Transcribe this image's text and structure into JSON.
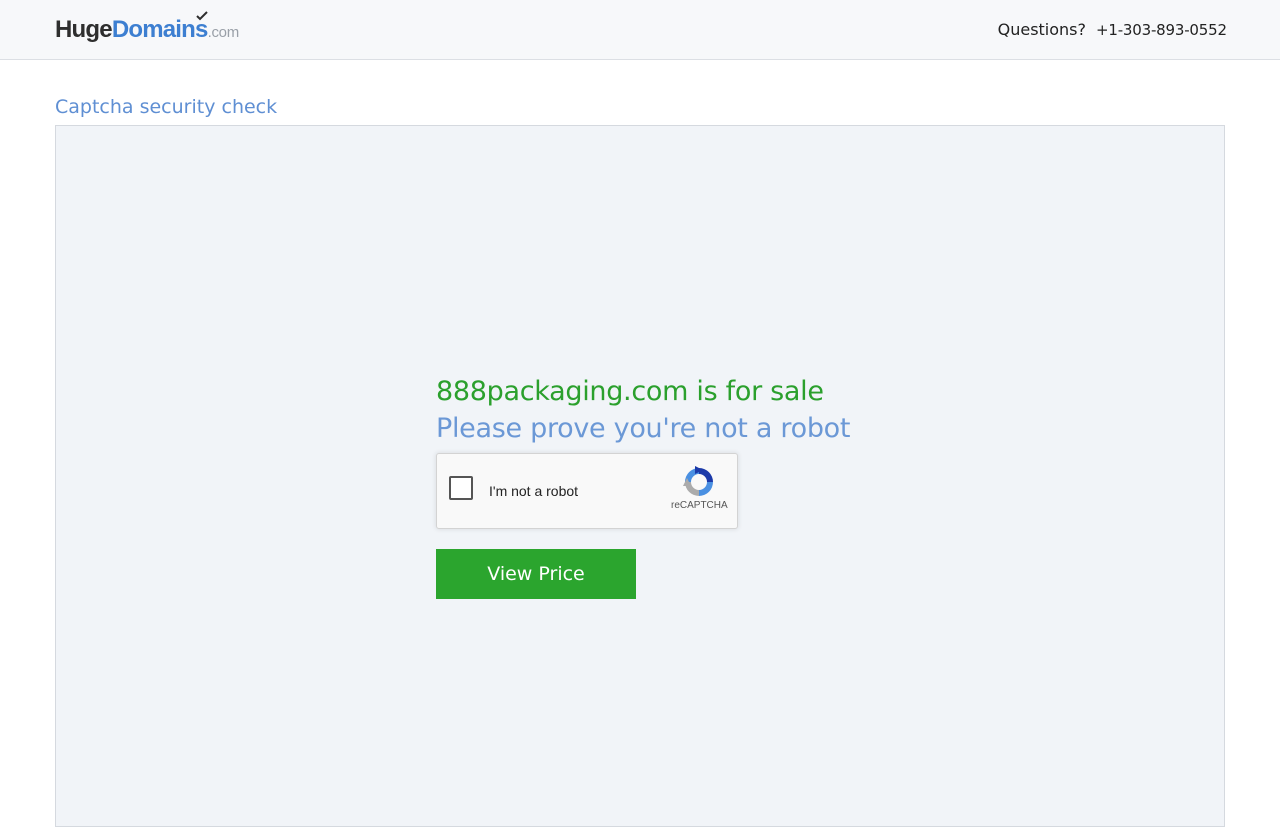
{
  "header": {
    "logo": {
      "huge": "Huge",
      "domains": "Domains",
      "tld": ".com"
    },
    "questions_label": "Questions?",
    "phone": "+1-303-893-0552"
  },
  "main": {
    "section_title": "Captcha security check",
    "sale_heading": "888packaging.com is for sale",
    "robot_heading": "Please prove you're not a robot",
    "recaptcha": {
      "checkbox_label": "I'm not a robot",
      "brand": "reCAPTCHA",
      "checked": false
    },
    "view_price_label": "View Price"
  },
  "colors": {
    "brand_blue": "#3d7fd1",
    "sale_green": "#2ba02d",
    "button_green": "#2ba52e",
    "heading_blue": "#6b98d6",
    "panel_bg": "#f1f4f8"
  },
  "icons": [
    "logo-check-icon",
    "recaptcha-logo-icon"
  ]
}
